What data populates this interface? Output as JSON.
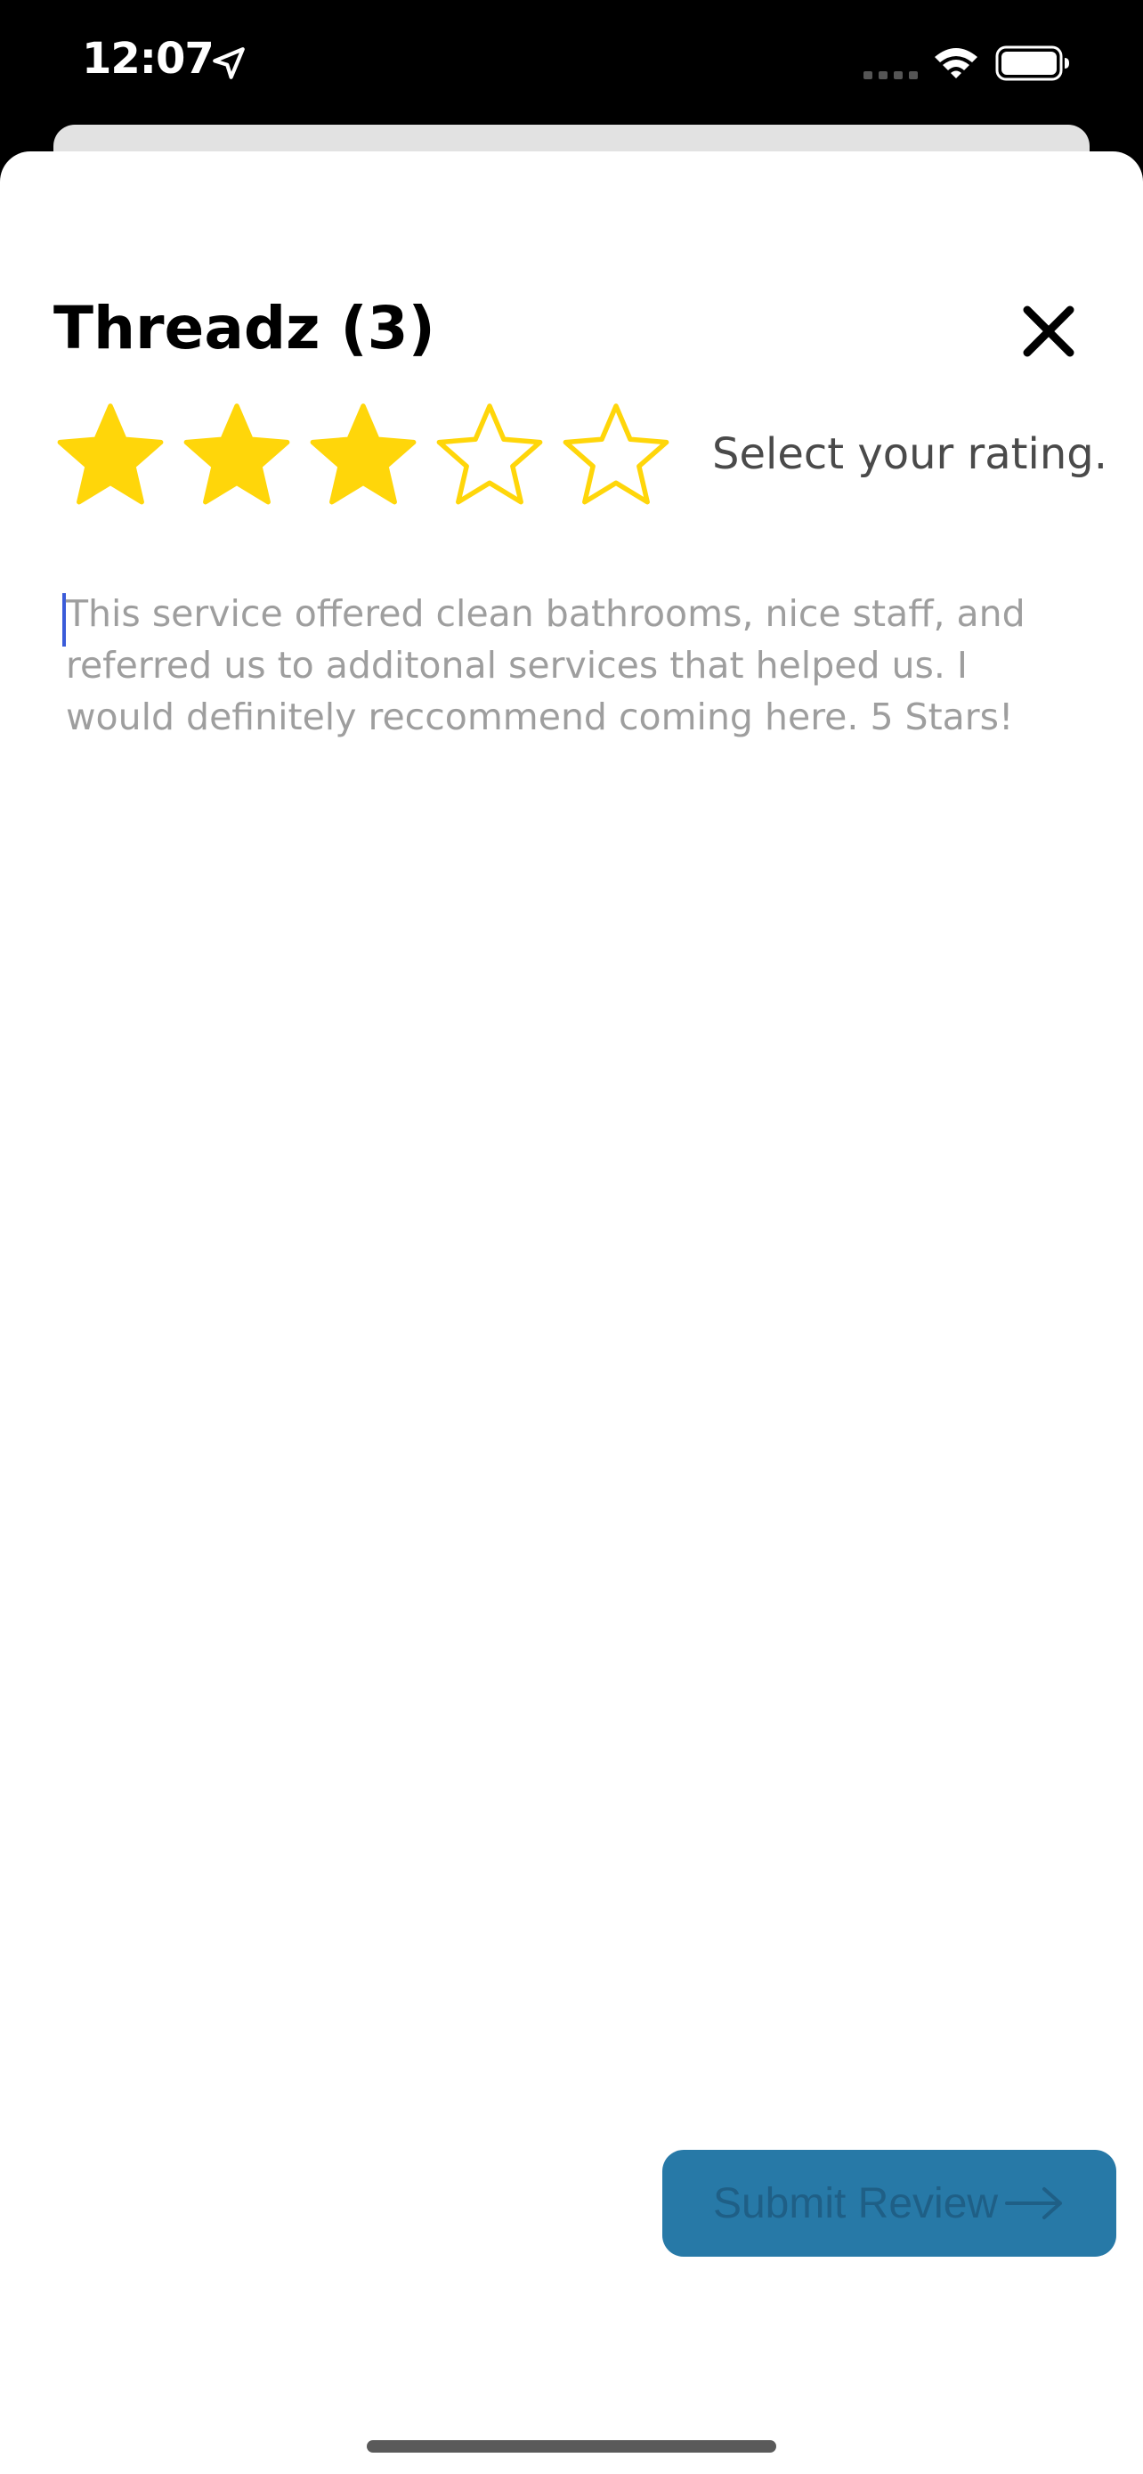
{
  "status_bar": {
    "time": "12:07",
    "icons": [
      "location-arrow-icon",
      "cellular-signal-icon",
      "wifi-icon",
      "battery-icon"
    ]
  },
  "review_sheet": {
    "title": "Threadz (3)",
    "close_icon": "close-icon",
    "rating": {
      "value": 3,
      "max": 5,
      "filled_color": "#FFD60A",
      "empty_color": "#FFD60A",
      "hint": "Select your rating."
    },
    "review_input": {
      "placeholder": "This service offered clean bathrooms, nice staff, and referred us to additonal services that helped us. I would definitely reccommend coming here. 5 Stars!"
    },
    "submit": {
      "label": "Submit Review",
      "icon": "arrow-right-icon",
      "background": "#2779A7"
    }
  }
}
